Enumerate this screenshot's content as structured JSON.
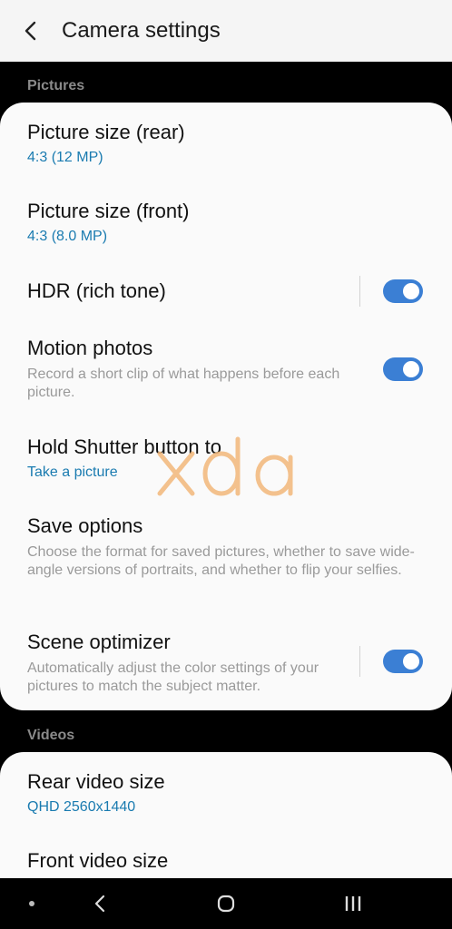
{
  "header": {
    "back_icon": "chevron-left-icon",
    "title": "Camera settings"
  },
  "sections": {
    "pictures_label": "Pictures",
    "videos_label": "Videos"
  },
  "pictures": {
    "picture_size_rear": {
      "title": "Picture size (rear)",
      "value": "4:3 (12 MP)"
    },
    "picture_size_front": {
      "title": "Picture size (front)",
      "value": "4:3 (8.0 MP)"
    },
    "hdr": {
      "title": "HDR (rich tone)",
      "enabled": true
    },
    "motion_photos": {
      "title": "Motion photos",
      "description": "Record a short clip of what happens before each picture.",
      "enabled": true
    },
    "hold_shutter": {
      "title": "Hold Shutter button to",
      "value": "Take a picture"
    },
    "save_options": {
      "title": "Save options",
      "description": "Choose the format for saved pictures, whether to save wide-angle versions of portraits, and whether to flip your selfies."
    },
    "scene_optimizer": {
      "title": "Scene optimizer",
      "description": "Automatically adjust the color settings of your pictures to match the subject matter.",
      "enabled": true
    }
  },
  "videos": {
    "rear_video_size": {
      "title": "Rear video size",
      "value": "QHD 2560x1440"
    },
    "front_video_size": {
      "title": "Front video size"
    }
  },
  "watermark": {
    "text": "xda",
    "color": "#f2b87a"
  },
  "colors": {
    "accent_blue": "#3b7fd4",
    "value_blue": "#1a7bb0"
  },
  "navbar": {
    "dot_icon": "dot-icon",
    "back_icon": "back-chevron-icon",
    "home_icon": "home-icon",
    "recents_icon": "recents-icon"
  }
}
